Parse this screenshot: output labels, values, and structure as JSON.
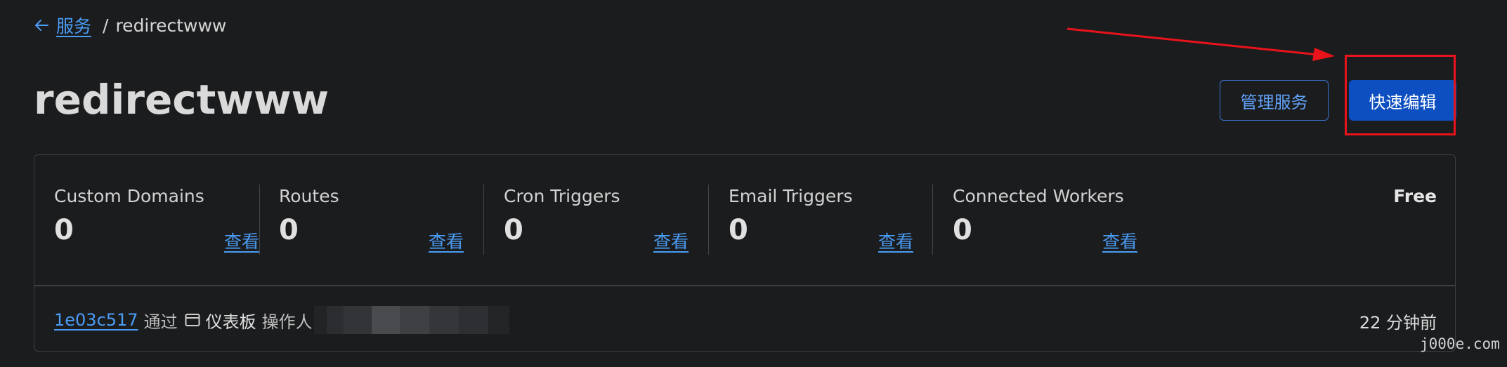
{
  "breadcrumb": {
    "back_label": "服务",
    "separator": "/",
    "current": "redirectwww"
  },
  "title": "redirectwww",
  "actions": {
    "manage_label": "管理服务",
    "quick_edit_label": "快速编辑"
  },
  "stats": [
    {
      "label": "Custom Domains",
      "value": "0",
      "link": "查看"
    },
    {
      "label": "Routes",
      "value": "0",
      "link": "查看"
    },
    {
      "label": "Cron Triggers",
      "value": "0",
      "link": "查看"
    },
    {
      "label": "Email Triggers",
      "value": "0",
      "link": "查看"
    },
    {
      "label": "Connected Workers",
      "value": "0",
      "link": "查看"
    }
  ],
  "plan": "Free",
  "deployment": {
    "commit": "1e03c517",
    "via": "通过",
    "source": "仪表板",
    "operator_label": "操作人",
    "time_ago": "22 分钟前"
  },
  "watermark": "j000e.com",
  "colors": {
    "background": "#1b1c1e",
    "link": "#4a9cf5",
    "primary_button": "#0d4fc0",
    "annotation": "#e8131b"
  },
  "icons": {
    "back": "arrow-left-icon",
    "source": "window-icon"
  }
}
